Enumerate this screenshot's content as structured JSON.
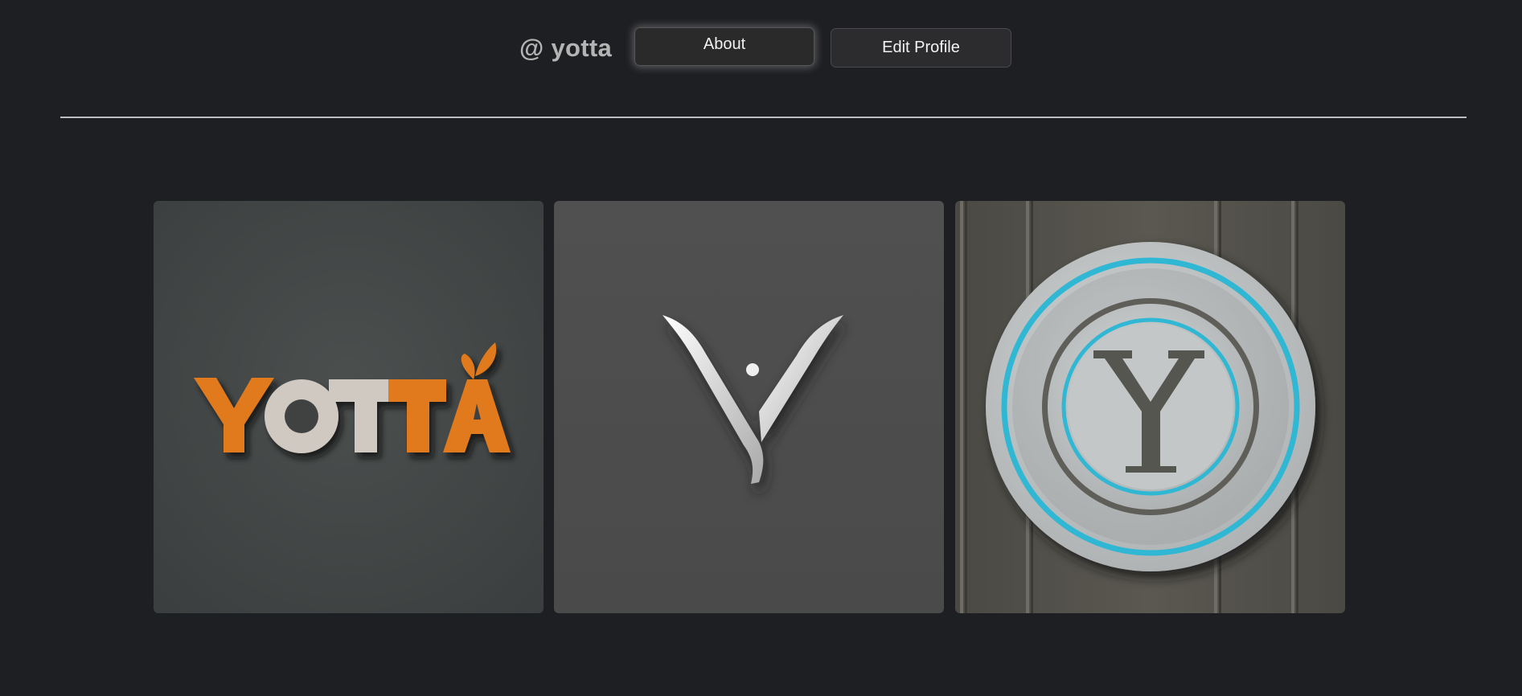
{
  "profile": {
    "handle": "@ yotta"
  },
  "actions": {
    "about_label": "About",
    "edit_label": "Edit Profile"
  },
  "gallery": {
    "items": [
      {
        "logo_text": "YOTTA"
      },
      {
        "logo_text": "Y"
      },
      {
        "logo_text": "Y"
      }
    ]
  },
  "colors": {
    "background": "#1e1f23",
    "accent_orange": "#e07a1c",
    "accent_cyan": "#2fb7d3"
  }
}
